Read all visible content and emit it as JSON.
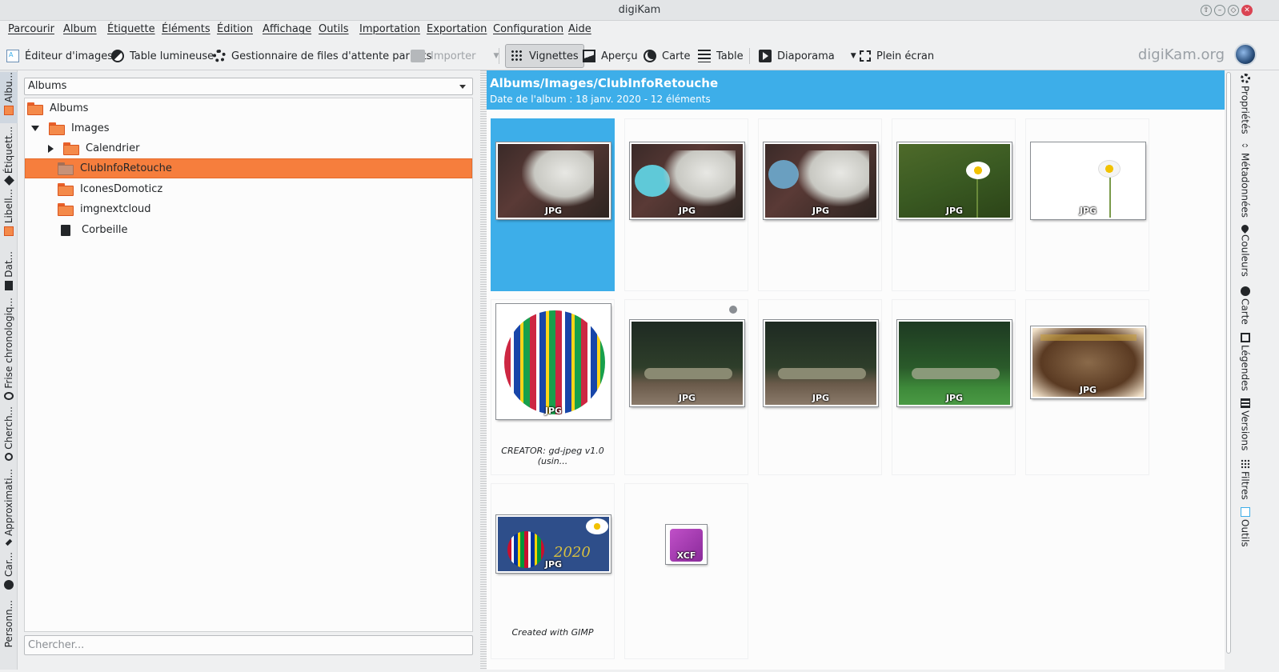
{
  "window": {
    "title": "digiKam"
  },
  "menu": [
    "Parcourir",
    "Album",
    "Étiquette",
    "Éléments",
    "Édition",
    "Affichage",
    "Outils",
    "Importation",
    "Exportation",
    "Configuration",
    "Aide"
  ],
  "toolbar": {
    "image_editor": "Éditeur d'images",
    "light_table": "Table lumineuse",
    "batch_queue": "Gestionnaire de files d'attente par lots",
    "import": "Importer",
    "thumbnails": "Vignettes",
    "preview": "Aperçu",
    "map": "Carte",
    "table": "Table",
    "slideshow": "Diaporama",
    "fullscreen": "Plein écran",
    "brand": "digiKam.org"
  },
  "left_tabs": [
    "Albu...",
    "Étiquett...",
    "Libell...",
    "Dat...",
    "Frise chronologiq...",
    "Cherch...",
    "Approximati...",
    "Car...",
    "Personn..."
  ],
  "left_panel": {
    "combo": "Albums",
    "tree": [
      {
        "label": "Albums",
        "level": 0,
        "expander": "none",
        "kind": "folder"
      },
      {
        "label": "Images",
        "level": 1,
        "expander": "open",
        "kind": "folder"
      },
      {
        "label": "Calendrier",
        "level": 2,
        "expander": "closed",
        "kind": "folder"
      },
      {
        "label": "ClubInfoRetouche",
        "level": 2,
        "expander": "none",
        "kind": "folder",
        "selected": true
      },
      {
        "label": "IconesDomoticz",
        "level": 2,
        "expander": "none",
        "kind": "folder"
      },
      {
        "label": "imgnextcloud",
        "level": 2,
        "expander": "none",
        "kind": "folder"
      },
      {
        "label": "Corbeille",
        "level": 2,
        "expander": "none",
        "kind": "trash"
      }
    ],
    "search_placeholder": "Chercher..."
  },
  "album": {
    "path": "Albums/Images/ClubInfoRetouche",
    "info": "Date de l'album : 18 janv. 2020 - 12 éléments"
  },
  "thumbs": [
    {
      "format": "JPG",
      "kind": "horse",
      "caption": "",
      "selected": true
    },
    {
      "format": "JPG",
      "kind": "horse-bubble",
      "caption": ""
    },
    {
      "format": "JPG",
      "kind": "horse-bubble2",
      "caption": ""
    },
    {
      "format": "JPG",
      "kind": "daisy-green",
      "caption": ""
    },
    {
      "format": "JPG",
      "kind": "daisy-white",
      "caption": ""
    },
    {
      "format": "JPG",
      "kind": "flag-globe",
      "caption": "CREATOR: gd-jpeg v1.0 (usin..."
    },
    {
      "format": "JPG",
      "kind": "forest",
      "caption": "",
      "geo": true
    },
    {
      "format": "JPG",
      "kind": "forest",
      "caption": ""
    },
    {
      "format": "JPG",
      "kind": "forest-green",
      "caption": ""
    },
    {
      "format": "JPG",
      "kind": "vintage",
      "caption": ""
    },
    {
      "format": "JPG",
      "kind": "card-2020",
      "caption": "Created with GIMP"
    },
    {
      "format": "XCF",
      "kind": "xcf",
      "caption": ""
    }
  ],
  "right_tabs": [
    "Propriétés",
    "Métadonnées",
    "Couleurs",
    "Carte",
    "Légendes",
    "Versions",
    "Filtres",
    "Outils"
  ],
  "colors": {
    "accent": "#3daee9",
    "selection": "#f67e3d",
    "folder": "#f48a4a"
  }
}
